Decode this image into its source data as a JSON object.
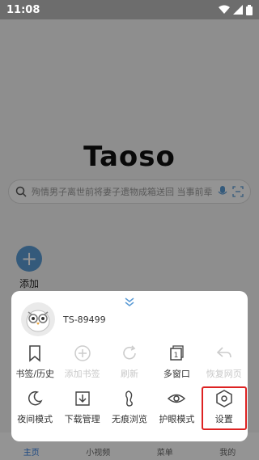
{
  "status_bar": {
    "time": "11:08"
  },
  "brand": {
    "logo_text": "Taoso"
  },
  "search": {
    "placeholder": "殉情男子离世前将妻子遗物成箱送回 当事前辈平常怎样为家接推"
  },
  "shortcut": {
    "add_label": "添加"
  },
  "bottom_nav": [
    {
      "label": "主页",
      "active": true
    },
    {
      "label": "小视频"
    },
    {
      "label": "菜单"
    },
    {
      "label": "我的"
    }
  ],
  "menu": {
    "username": "TS-89499",
    "row1": [
      {
        "label": "书签/历史",
        "icon": "bookmark-icon",
        "enabled": true
      },
      {
        "label": "添加书签",
        "icon": "plus-circle-icon",
        "enabled": false
      },
      {
        "label": "刷新",
        "icon": "refresh-icon",
        "enabled": false
      },
      {
        "label": "多窗口",
        "icon": "windows-icon",
        "enabled": true,
        "badge": "1"
      },
      {
        "label": "恢复网页",
        "icon": "undo-icon",
        "enabled": false
      }
    ],
    "row2": [
      {
        "label": "夜间模式",
        "icon": "moon-icon",
        "enabled": true
      },
      {
        "label": "下载管理",
        "icon": "download-icon",
        "enabled": true
      },
      {
        "label": "无痕浏览",
        "icon": "footprint-icon",
        "enabled": true
      },
      {
        "label": "护眼模式",
        "icon": "eye-icon",
        "enabled": true
      },
      {
        "label": "设置",
        "icon": "settings-icon",
        "enabled": true,
        "highlighted": true
      }
    ]
  },
  "colors": {
    "accent": "#2e7be0",
    "highlight": "#dd2222",
    "disabled": "#c8c8c8"
  }
}
